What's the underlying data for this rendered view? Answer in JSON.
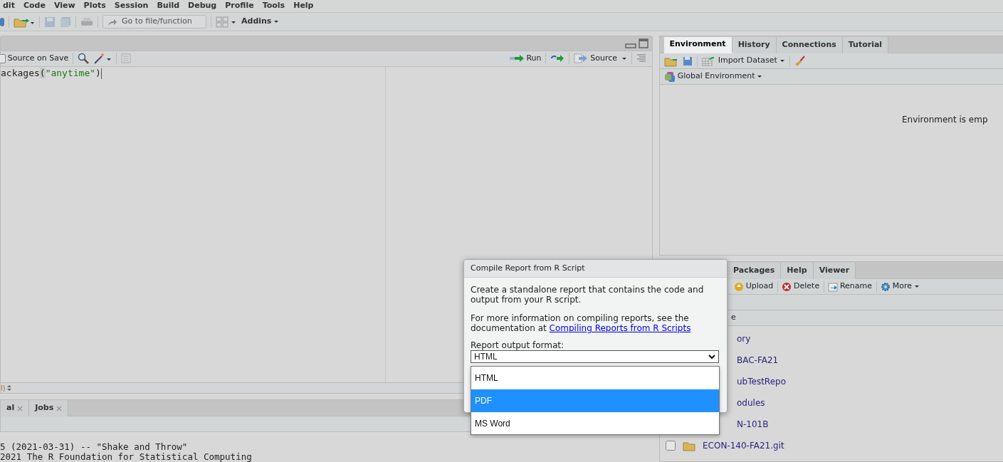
{
  "menu": [
    "dit",
    "Code",
    "View",
    "Plots",
    "Session",
    "Build",
    "Debug",
    "Profile",
    "Tools",
    "Help"
  ],
  "toolbar": {
    "goto_placeholder": "Go to file/function",
    "addins": "Addins"
  },
  "editor": {
    "source_on_save": {
      "label": "Source on Save",
      "checked": false
    },
    "run": "Run",
    "source": "Source",
    "code": [
      {
        "text": "ackages",
        "kind": "plain"
      },
      {
        "text": "(",
        "kind": "paren"
      },
      {
        "text": "\"anytime\"",
        "kind": "string"
      },
      {
        "text": ")",
        "kind": "plain"
      }
    ],
    "status": "l)"
  },
  "console": {
    "tabs": [
      {
        "label": "al",
        "selected": false
      },
      {
        "label": "Jobs",
        "selected": false
      }
    ],
    "lines": [
      "5 (2021-03-31) -- \"Shake and Throw\"",
      "2021 The R Foundation for Statistical Computing"
    ]
  },
  "environment_pane": {
    "tabs": [
      {
        "label": "Environment",
        "selected": true
      },
      {
        "label": "History",
        "selected": false
      },
      {
        "label": "Connections",
        "selected": false
      },
      {
        "label": "Tutorial",
        "selected": false
      }
    ],
    "import": "Import Dataset",
    "scope": "Global Environment",
    "empty_message": "Environment is emp"
  },
  "files_pane": {
    "tabs": [
      {
        "label": "Packages",
        "selected": false
      },
      {
        "label": "Help",
        "selected": false
      },
      {
        "label": "Viewer",
        "selected": false
      }
    ],
    "actions": [
      {
        "label": "Upload",
        "kind": "upload"
      },
      {
        "label": "Delete",
        "kind": "delete"
      },
      {
        "label": "Rename",
        "kind": "rename"
      },
      {
        "label": "More",
        "kind": "more"
      }
    ],
    "header": "e",
    "rows": [
      {
        "name": "ory",
        "kind": "cut"
      },
      {
        "name": "BAC-FA21",
        "kind": "cut"
      },
      {
        "name": "ubTestRepo",
        "kind": "cut"
      },
      {
        "name": "odules",
        "kind": "cut"
      },
      {
        "name": "N-101B",
        "kind": "cut"
      },
      {
        "name": "ECON-140-FA21.git",
        "kind": "folder",
        "checked": false
      }
    ]
  },
  "dialog": {
    "title": "Compile Report from R Script",
    "intro": "Create a standalone report that contains the code and output from your R script.",
    "info": "For more information on compiling reports, see the documentation at ",
    "link": "Compiling Reports from R Scripts",
    "format_label": "Report output format:",
    "select_value": "HTML",
    "options": [
      {
        "label": "HTML",
        "selected": false
      },
      {
        "label": "PDF",
        "selected": true
      },
      {
        "label": "MS Word",
        "selected": false
      }
    ]
  }
}
